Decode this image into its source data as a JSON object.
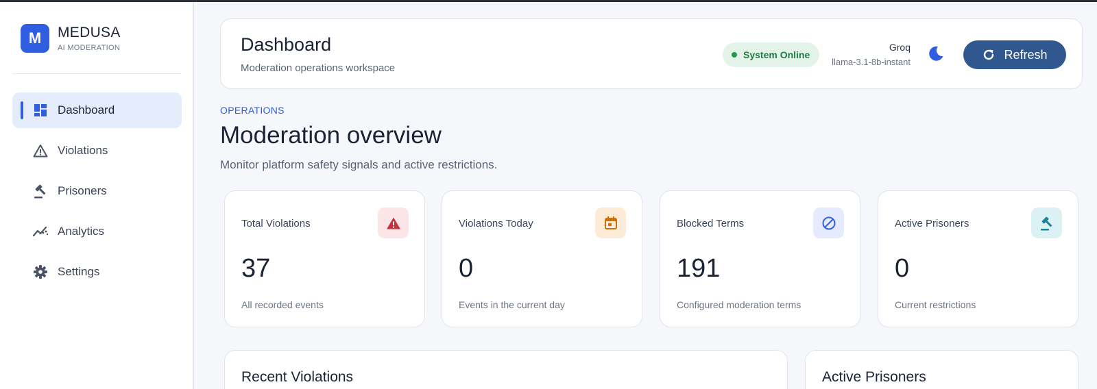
{
  "brand": {
    "logo_letter": "M",
    "name": "MEDUSA",
    "subtitle": "AI MODERATION"
  },
  "sidebar": {
    "items": [
      {
        "label": "Dashboard",
        "icon": "dashboard-icon",
        "active": true
      },
      {
        "label": "Violations",
        "icon": "warning-icon",
        "active": false
      },
      {
        "label": "Prisoners",
        "icon": "gavel-icon",
        "active": false
      },
      {
        "label": "Analytics",
        "icon": "analytics-icon",
        "active": false
      },
      {
        "label": "Settings",
        "icon": "gear-icon",
        "active": false
      }
    ]
  },
  "header": {
    "title": "Dashboard",
    "subtitle": "Moderation operations workspace",
    "status": "System Online",
    "provider": "Groq",
    "model": "llama-3.1-8b-instant",
    "theme_icon": "moon-icon",
    "refresh_label": "Refresh"
  },
  "overview": {
    "eyebrow": "OPERATIONS",
    "title": "Moderation overview",
    "description": "Monitor platform safety signals and active restrictions."
  },
  "cards": [
    {
      "label": "Total Violations",
      "value": "37",
      "foot": "All recorded events",
      "icon": "warning-icon",
      "color": "#c8323c",
      "bg": "#fbe5e7"
    },
    {
      "label": "Violations Today",
      "value": "0",
      "foot": "Events in the current day",
      "icon": "calendar-icon",
      "color": "#c9730f",
      "bg": "#fcebd6"
    },
    {
      "label": "Blocked Terms",
      "value": "191",
      "foot": "Configured moderation terms",
      "icon": "block-icon",
      "color": "#2f5fe0",
      "bg": "#e5ebfc"
    },
    {
      "label": "Active Prisoners",
      "value": "0",
      "foot": "Current restrictions",
      "icon": "gavel-icon",
      "color": "#17849a",
      "bg": "#dcf1f3"
    }
  ],
  "panels": {
    "recent_violations": "Recent Violations",
    "active_prisoners": "Active Prisoners"
  },
  "colors": {
    "accent": "#2f5fe0",
    "refresh": "#30588f",
    "online": "#1f9a4f"
  }
}
